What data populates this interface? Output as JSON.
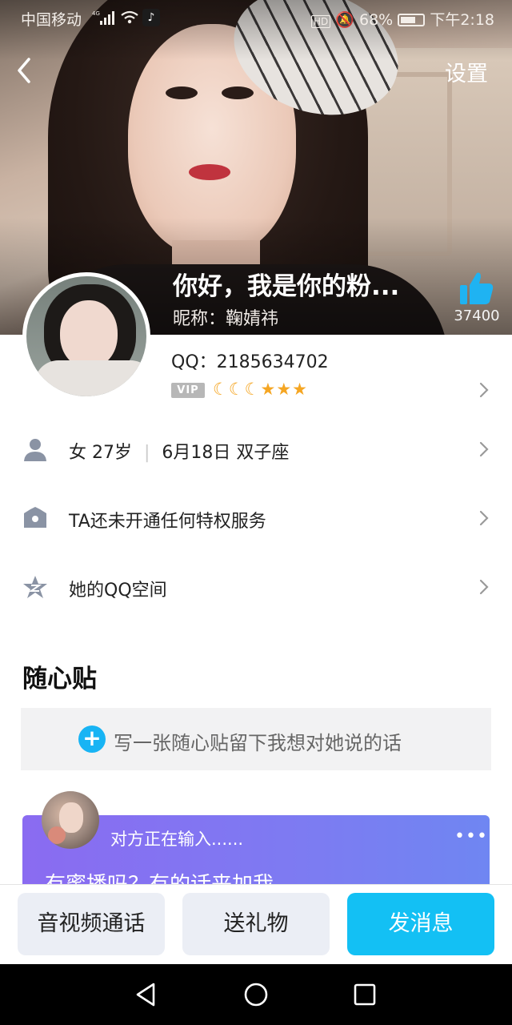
{
  "status_bar": {
    "carrier": "中国移动",
    "network": "4G",
    "app_icon": "tiktok-icon",
    "battery": "68%",
    "time": "下午2:18"
  },
  "header": {
    "back_icon": "chevron-left-icon",
    "settings_label": "设置",
    "title": "你好，我是你的粉...",
    "nickname_line": "昵称：鞠婧祎",
    "like_icon": "thumbs-up-icon",
    "like_count": "37400"
  },
  "profile": {
    "qq_line": "QQ：2185634702",
    "vip_label": "VIP",
    "level_icons": [
      "moon-icon",
      "moon-icon",
      "moon-icon",
      "star-icon",
      "star-icon",
      "star-icon"
    ]
  },
  "info_rows": [
    {
      "icon": "person-icon",
      "text_a": "女  27岁",
      "text_b": "6月18日  双子座"
    },
    {
      "icon": "crown-icon",
      "text": "TA还未开通任何特权服务"
    },
    {
      "icon": "qzone-star-icon",
      "text": "她的QQ空间"
    }
  ],
  "sticky_notes": {
    "title": "随心贴",
    "write_prompt": "写一张随心贴留下我想对她说的话",
    "card": {
      "typing": "对方正在输入......",
      "more": "•••",
      "body": "有蜜播吗？有的话来加我"
    }
  },
  "actions": {
    "call": "音视频通话",
    "gift": "送礼物",
    "message": "发消息"
  },
  "colors": {
    "accent": "#13c0f4",
    "card_gradient_start": "#8a6bf1",
    "card_gradient_end": "#6f86f2",
    "vip_gray": "#b7b7b7",
    "level_gold": "#f5a623"
  }
}
